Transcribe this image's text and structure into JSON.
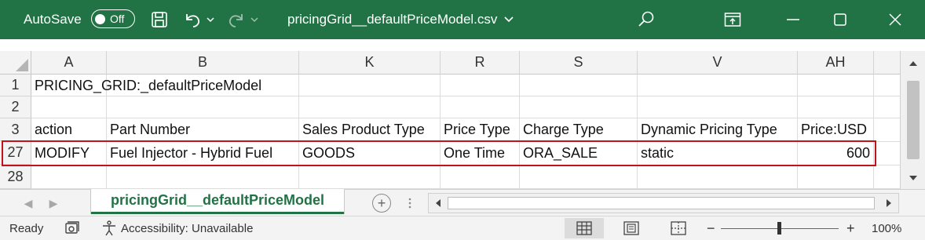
{
  "titlebar": {
    "autosave_label": "AutoSave",
    "autosave_state": "Off",
    "file_name": "pricingGrid__defaultPriceModel.csv",
    "bg_color": "#217346"
  },
  "columns": [
    "A",
    "B",
    "K",
    "R",
    "S",
    "V",
    "AH"
  ],
  "rows": [
    {
      "num": "1",
      "cells": [
        "PRICING_GRID:_defaultPriceModel",
        "",
        "",
        "",
        "",
        "",
        ""
      ]
    },
    {
      "num": "2",
      "cells": [
        "",
        "",
        "",
        "",
        "",
        "",
        ""
      ]
    },
    {
      "num": "3",
      "cells": [
        "action",
        "Part Number",
        "Sales Product Type",
        "Price Type",
        "Charge Type",
        "Dynamic Pricing Type",
        "Price:USD"
      ]
    },
    {
      "num": "27",
      "cells": [
        "MODIFY",
        "Fuel Injector - Hybrid Fuel",
        "GOODS",
        "One Time",
        "ORA_SALE",
        "static",
        "600"
      ]
    },
    {
      "num": "28",
      "cells": [
        "",
        "",
        "",
        "",
        "",
        "",
        ""
      ]
    }
  ],
  "sheet_tab": "pricingGrid__defaultPriceModel",
  "statusbar": {
    "ready": "Ready",
    "accessibility": "Accessibility: Unavailable",
    "zoom_minus": "−",
    "zoom_plus": "+",
    "zoom": "100%"
  },
  "accent_color": "#217346",
  "highlight_color": "#c0141b"
}
